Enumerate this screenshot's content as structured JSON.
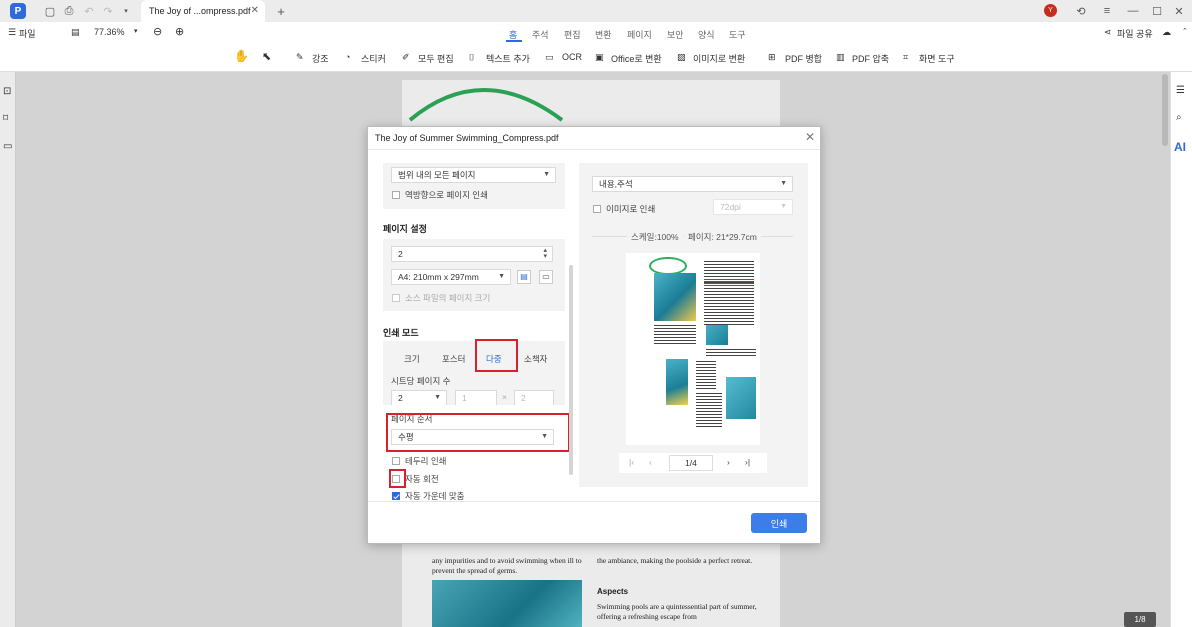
{
  "tab": {
    "title": "The Joy of ...ompress.pdf"
  },
  "toolbar": {
    "file": "파일",
    "zoom": "77.36%",
    "share": "파일 공유"
  },
  "menu": [
    "홈",
    "주석",
    "편집",
    "변환",
    "페이지",
    "보안",
    "양식",
    "도구"
  ],
  "tools": [
    "강조",
    "스티커",
    "모두 편집",
    "텍스트 추가",
    "OCR",
    "Office로 변환",
    "이미지로 변환",
    "PDF 병합",
    "PDF 압축",
    "화면 도구"
  ],
  "dialog": {
    "title": "The Joy of Summer Swimming_Compress.pdf",
    "range": "범위 내의 모든 페이지",
    "reverse": "역방향으로 페이지 인쇄",
    "page_setup": "페이지 설정",
    "copies": "2",
    "paper": "A4: 210mm x 297mm",
    "source_size": "소스 파일의 페이지 크기",
    "print_mode": "인쇄 모드",
    "mode_tabs": [
      "크기",
      "포스터",
      "다중",
      "소책자"
    ],
    "pages_per_sheet": "시트당 페이지 수",
    "pps_value": "2",
    "pps_rows": "1",
    "pps_times": "×",
    "pps_cols": "2",
    "page_order": "페이지 순서",
    "order_value": "수평",
    "border": "테두리 인쇄",
    "auto_rotate": "자동 회전",
    "auto_center": "자동 가운데 맞춤",
    "content": "내용,주석",
    "as_image": "이미지로 인쇄",
    "dpi": "72dpi",
    "scale": "스케일:100%",
    "page_size": "페이지: 21*29.7cm",
    "pager": "1/4",
    "print": "인쇄"
  },
  "doc": {
    "text1": "any impurities and to avoid swimming when ill to prevent the spread of germs.",
    "text2": "the ambiance, making the poolside a perfect retreat.",
    "heading": "Aspects",
    "text3": "Swimming pools are a quintessential part of summer, offering a refreshing escape from"
  },
  "page_badge": "1/8",
  "colors": {
    "accent": "#2f6bd8",
    "highlight": "#d4232d",
    "brand": "#3c7de8"
  }
}
